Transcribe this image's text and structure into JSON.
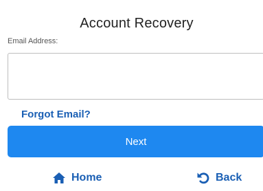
{
  "page": {
    "title": "Account Recovery"
  },
  "form": {
    "email_label": "Email Address:",
    "email_value": "",
    "email_placeholder": ""
  },
  "links": {
    "forgot_email": "Forgot Email?"
  },
  "buttons": {
    "next_label": "Next"
  },
  "nav": {
    "home_label": "Home",
    "home_icon": "home-icon",
    "back_label": "Back",
    "back_icon": "undo-icon"
  },
  "colors": {
    "primary_button": "#1e88f0",
    "link": "#1a5fb4"
  }
}
